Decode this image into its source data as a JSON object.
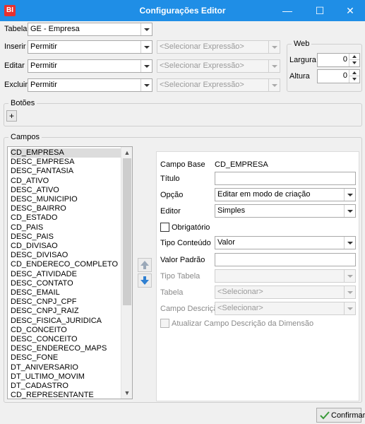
{
  "window": {
    "title": "Configurações Editor",
    "app_icon_text": "BI",
    "minimize": "—",
    "maximize": "☐",
    "close": "✕"
  },
  "top": {
    "tabela_label": "Tabela",
    "tabela_value": "GE - Empresa",
    "inserir_label": "Inserir",
    "inserir_value": "Permitir",
    "inserir_expr": "<Selecionar Expressão>",
    "editar_label": "Editar",
    "editar_value": "Permitir",
    "editar_expr": "<Selecionar Expressão>",
    "excluir_label": "Excluir",
    "excluir_value": "Permitir",
    "excluir_expr": "<Selecionar Expressão>"
  },
  "web": {
    "legend": "Web",
    "largura_label": "Largura",
    "largura_value": "0",
    "altura_label": "Altura",
    "altura_value": "0"
  },
  "botoes": {
    "legend": "Botões",
    "add_label": "+"
  },
  "campos": {
    "legend": "Campos",
    "items": [
      "CD_EMPRESA",
      "DESC_EMPRESA",
      "DESC_FANTASIA",
      "CD_ATIVO",
      "DESC_ATIVO",
      "DESC_MUNICIPIO",
      "DESC_BAIRRO",
      "CD_ESTADO",
      "CD_PAIS",
      "DESC_PAIS",
      "CD_DIVISAO",
      "DESC_DIVISAO",
      "CD_ENDERECO_COMPLETO",
      "DESC_ATIVIDADE",
      "DESC_CONTATO",
      "DESC_EMAIL",
      "DESC_CNPJ_CPF",
      "DESC_CNPJ_RAIZ",
      "DESC_FISICA_JURIDICA",
      "CD_CONCEITO",
      "DESC_CONCEITO",
      "DESC_ENDERECO_MAPS",
      "DESC_FONE",
      "DT_ANIVERSARIO",
      "DT_ULTIMO_MOVIM",
      "DT_CADASTRO",
      "CD_REPRESENTANTE"
    ],
    "selected": "CD_EMPRESA"
  },
  "props": {
    "campo_base_label": "Campo Base",
    "campo_base_value": "CD_EMPRESA",
    "titulo_label": "Título",
    "titulo_value": "",
    "opcao_label": "Opção",
    "opcao_value": "Editar em modo de criação",
    "editor_label": "Editor",
    "editor_value": "Simples",
    "obrigatorio_label": "Obrigatório",
    "tipo_conteudo_label": "Tipo Conteúdo",
    "tipo_conteudo_value": "Valor",
    "valor_padrao_label": "Valor Padrão",
    "valor_padrao_value": "",
    "tipo_tabela_label": "Tipo Tabela",
    "tipo_tabela_value": "",
    "tabela_label": "Tabela",
    "tabela_value": "<Selecionar>",
    "campo_descricao_label": "Campo Descrição",
    "campo_descricao_value": "<Selecionar>",
    "atualizar_label": "Atualizar Campo Descrição da Dimensão"
  },
  "footer": {
    "confirm_label": "Confirmar"
  },
  "colors": {
    "titlebar": "#1f8ee6",
    "app_icon": "#e8312f",
    "arrow_blue": "#2e7fd1",
    "confirm_check": "#3a9a3a"
  }
}
